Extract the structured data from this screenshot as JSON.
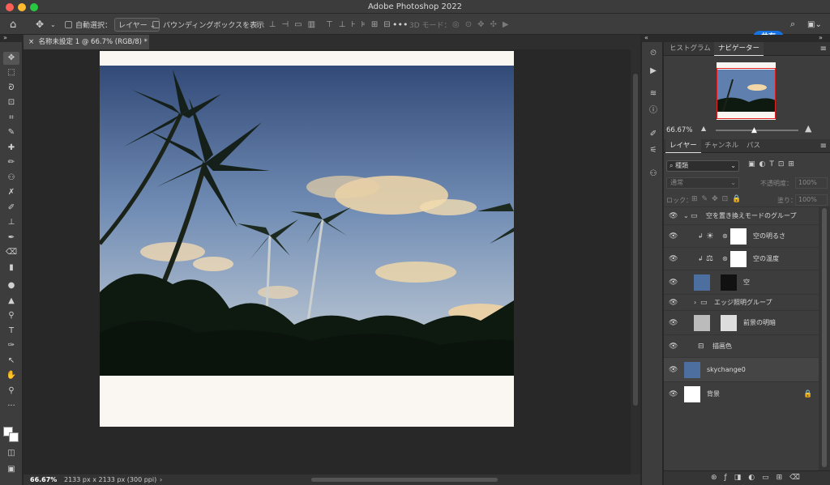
{
  "window": {
    "title": "Adobe Photoshop 2022"
  },
  "options": {
    "auto_select_label": "自動選択：",
    "layer_select": "レイヤー",
    "bbox_label": "バウンディングボックスを表示",
    "threed_mode": "3D モード：",
    "share_label": "共有"
  },
  "document": {
    "tab_title": "名称未設定 1 @ 66.7% (RGB/8) *",
    "zoom": "66.67%",
    "doc_info": "2133 px x 2133 px (300 ppi)"
  },
  "panels": {
    "histogram_tab": "ヒストグラム",
    "navigator_tab": "ナビゲーター",
    "nav_zoom": "66.67%",
    "layers_tab": "レイヤー",
    "channels_tab": "チャンネル",
    "paths_tab": "パス",
    "filter_kind": "種類",
    "blend_mode": "通常",
    "opacity_label": "不透明度：",
    "opacity_value": "100%",
    "lock_label": "ロック：",
    "fill_label": "塗り：",
    "fill_value": "100%"
  },
  "layers": [
    {
      "name": "空を置き換えモードのグループ",
      "type": "group"
    },
    {
      "name": "空の明るさ",
      "type": "adjust"
    },
    {
      "name": "空の温度",
      "type": "adjust"
    },
    {
      "name": "空",
      "type": "masked"
    },
    {
      "name": "エッジ照明グループ",
      "type": "group"
    },
    {
      "name": "前景の明暗",
      "type": "masked"
    },
    {
      "name": "描画色",
      "type": "fill"
    },
    {
      "name": "skychange0",
      "type": "image"
    },
    {
      "name": "背景",
      "type": "bg"
    }
  ],
  "icons": {
    "home": "home-icon",
    "move": "move-icon",
    "search": "search-icon",
    "lock": "lock-icon"
  }
}
